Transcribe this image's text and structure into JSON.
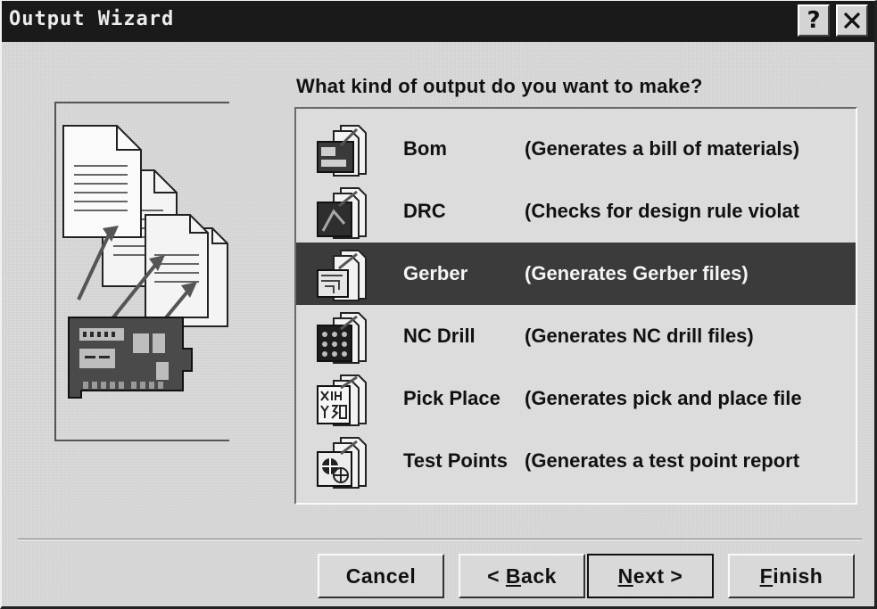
{
  "window": {
    "title": "Output Wizard"
  },
  "titlebar": {
    "help_label": "?"
  },
  "prompt": "What kind of output do you want to make?",
  "list": {
    "selected_index": 2,
    "items": [
      {
        "name": "Bom",
        "description": "(Generates a bill of materials)",
        "icon": "bom-icon"
      },
      {
        "name": "DRC",
        "description": "(Checks for design rule violat",
        "icon": "drc-icon"
      },
      {
        "name": "Gerber",
        "description": "(Generates Gerber files)",
        "icon": "gerber-icon"
      },
      {
        "name": "NC Drill",
        "description": "(Generates NC drill files)",
        "icon": "nc-drill-icon"
      },
      {
        "name": "Pick Place",
        "description": "(Generates pick and place file",
        "icon": "pick-place-icon"
      },
      {
        "name": "Test Points",
        "description": "(Generates a test point report",
        "icon": "test-points-icon"
      }
    ]
  },
  "buttons": {
    "cancel": "Cancel",
    "back_prefix": "< ",
    "back_mnemonic": "B",
    "back_rest": "ack",
    "next_mnemonic": "N",
    "next_rest": "ext >",
    "finish_mnemonic": "F",
    "finish_rest": "inish"
  },
  "colors": {
    "titlebar": "#1a1a1a",
    "selection": "#3b3b3b",
    "face": "#d9d9d9"
  }
}
